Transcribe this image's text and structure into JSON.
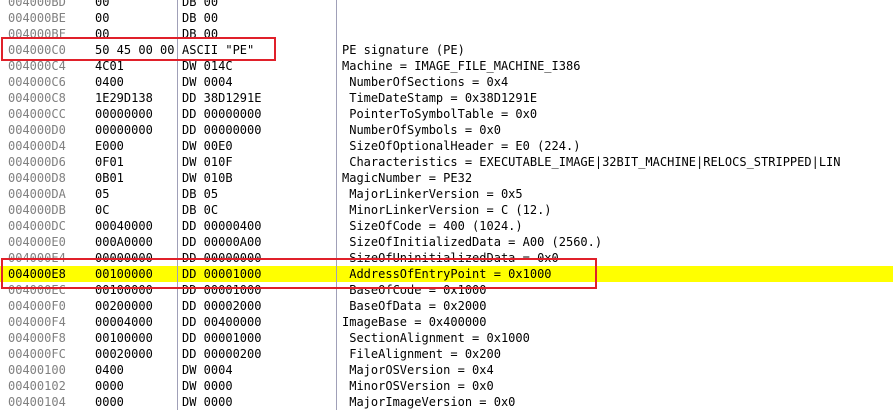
{
  "highlight_color": "#ffff00",
  "annotation_color": "#e0202a",
  "rows": [
    {
      "addr": "004000BD",
      "hex": "00",
      "dis": "DB 00",
      "cmt": ""
    },
    {
      "addr": "004000BE",
      "hex": "00",
      "dis": "DB 00",
      "cmt": ""
    },
    {
      "addr": "004000BF",
      "hex": "00",
      "dis": "DB 00",
      "cmt": ""
    },
    {
      "addr": "004000C0",
      "hex": "50 45 00 00",
      "dis": "ASCII \"PE\"",
      "cmt": "PE signature (PE)"
    },
    {
      "addr": "004000C4",
      "hex": "4C01",
      "dis": "DW 014C",
      "cmt": "Machine = IMAGE_FILE_MACHINE_I386"
    },
    {
      "addr": "004000C6",
      "hex": "0400",
      "dis": "DW 0004",
      "cmt": " NumberOfSections = 0x4"
    },
    {
      "addr": "004000C8",
      "hex": "1E29D138",
      "dis": "DD 38D1291E",
      "cmt": " TimeDateStamp = 0x38D1291E"
    },
    {
      "addr": "004000CC",
      "hex": "00000000",
      "dis": "DD 00000000",
      "cmt": " PointerToSymbolTable = 0x0"
    },
    {
      "addr": "004000D0",
      "hex": "00000000",
      "dis": "DD 00000000",
      "cmt": " NumberOfSymbols = 0x0"
    },
    {
      "addr": "004000D4",
      "hex": "E000",
      "dis": "DW 00E0",
      "cmt": " SizeOfOptionalHeader = E0 (224.)"
    },
    {
      "addr": "004000D6",
      "hex": "0F01",
      "dis": "DW 010F",
      "cmt": " Characteristics = EXECUTABLE_IMAGE|32BIT_MACHINE|RELOCS_STRIPPED|LIN"
    },
    {
      "addr": "004000D8",
      "hex": "0B01",
      "dis": "DW 010B",
      "cmt": "MagicNumber = PE32"
    },
    {
      "addr": "004000DA",
      "hex": "05",
      "dis": "DB 05",
      "cmt": " MajorLinkerVersion = 0x5"
    },
    {
      "addr": "004000DB",
      "hex": "0C",
      "dis": "DB 0C",
      "cmt": " MinorLinkerVersion = C (12.)"
    },
    {
      "addr": "004000DC",
      "hex": "00040000",
      "dis": "DD 00000400",
      "cmt": " SizeOfCode = 400 (1024.)"
    },
    {
      "addr": "004000E0",
      "hex": "000A0000",
      "dis": "DD 00000A00",
      "cmt": " SizeOfInitializedData = A00 (2560.)"
    },
    {
      "addr": "004000E4",
      "hex": "00000000",
      "dis": "DD 00000000",
      "cmt": " SizeOfUninitializedData = 0x0"
    },
    {
      "addr": "004000E8",
      "hex": "00100000",
      "dis": "DD 00001000",
      "cmt": " AddressOfEntryPoint = 0x1000",
      "highlight": true
    },
    {
      "addr": "004000EC",
      "hex": "00100000",
      "dis": "DD 00001000",
      "cmt": " BaseOfCode = 0x1000"
    },
    {
      "addr": "004000F0",
      "hex": "00200000",
      "dis": "DD 00002000",
      "cmt": " BaseOfData = 0x2000"
    },
    {
      "addr": "004000F4",
      "hex": "00004000",
      "dis": "DD 00400000",
      "cmt": "ImageBase = 0x400000"
    },
    {
      "addr": "004000F8",
      "hex": "00100000",
      "dis": "DD 00001000",
      "cmt": " SectionAlignment = 0x1000"
    },
    {
      "addr": "004000FC",
      "hex": "00020000",
      "dis": "DD 00000200",
      "cmt": " FileAlignment = 0x200"
    },
    {
      "addr": "00400100",
      "hex": "0400",
      "dis": "DW 0004",
      "cmt": " MajorOSVersion = 0x4"
    },
    {
      "addr": "00400102",
      "hex": "0000",
      "dis": "DW 0000",
      "cmt": " MinorOSVersion = 0x0"
    },
    {
      "addr": "00400104",
      "hex": "0000",
      "dis": "DW 0000",
      "cmt": " MajorImageVersion = 0x0"
    }
  ]
}
